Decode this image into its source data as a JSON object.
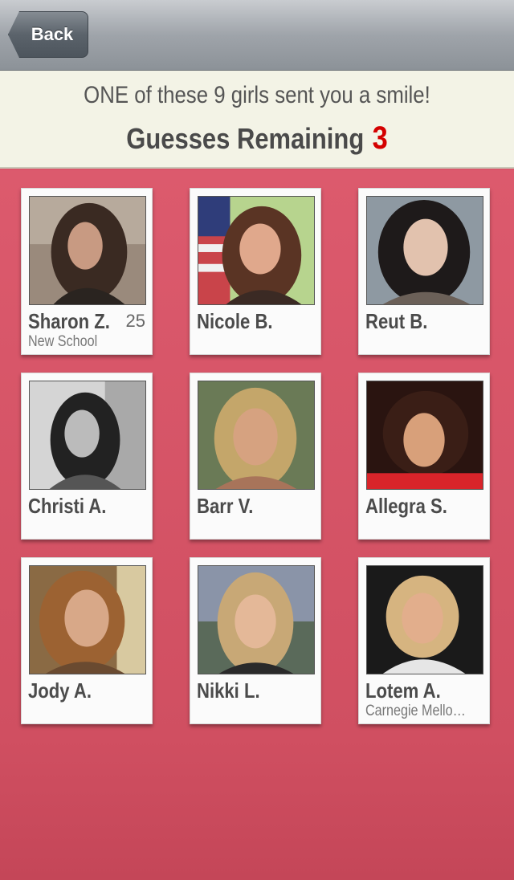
{
  "navbar": {
    "back_label": "Back"
  },
  "header": {
    "message": "ONE of these 9 girls sent you a smile!",
    "guesses_label": "Guesses Remaining",
    "guesses_count": "3",
    "count_color": "#d40000"
  },
  "cards": [
    {
      "name": "Sharon Z.",
      "age": "25",
      "school": "New School"
    },
    {
      "name": "Nicole B.",
      "age": "",
      "school": ""
    },
    {
      "name": "Reut B.",
      "age": "",
      "school": ""
    },
    {
      "name": "Christi A.",
      "age": "",
      "school": ""
    },
    {
      "name": "Barr V.",
      "age": "",
      "school": ""
    },
    {
      "name": "Allegra S.",
      "age": "",
      "school": ""
    },
    {
      "name": "Jody A.",
      "age": "",
      "school": ""
    },
    {
      "name": "Nikki L.",
      "age": "",
      "school": ""
    },
    {
      "name": "Lotem A.",
      "age": "",
      "school": "Carnegie Mello…"
    }
  ]
}
